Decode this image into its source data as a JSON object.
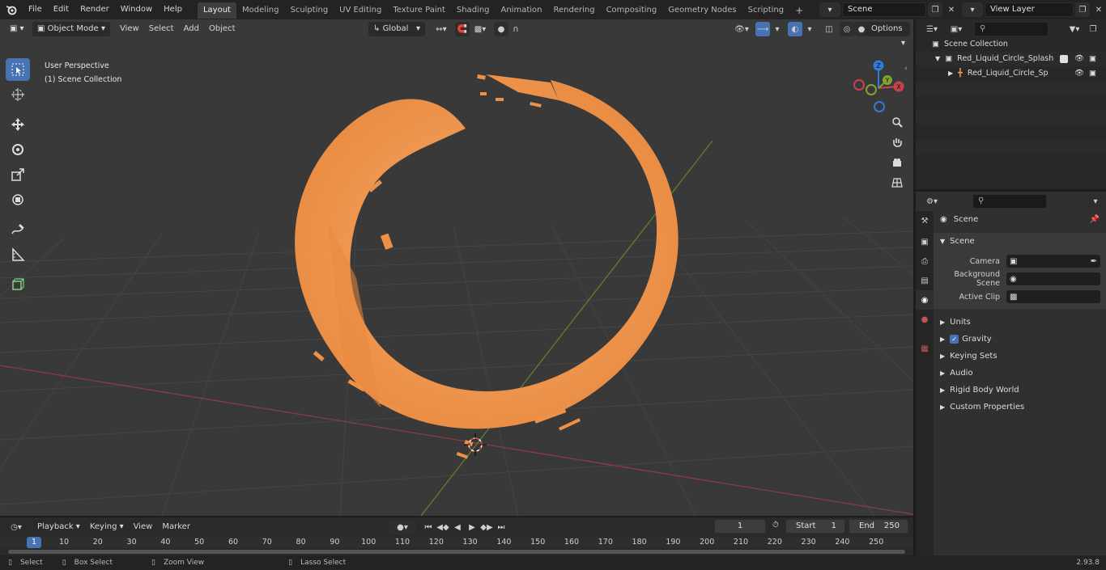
{
  "topbar": {
    "menus": [
      "File",
      "Edit",
      "Render",
      "Window",
      "Help"
    ],
    "workspaces": [
      "Layout",
      "Modeling",
      "Sculpting",
      "UV Editing",
      "Texture Paint",
      "Shading",
      "Animation",
      "Rendering",
      "Compositing",
      "Geometry Nodes",
      "Scripting"
    ],
    "active_workspace": "Layout",
    "add_tab": "+",
    "scene": "Scene",
    "view_layer": "View Layer"
  },
  "viewport": {
    "mode": "Object Mode",
    "menus": [
      "View",
      "Select",
      "Add",
      "Object"
    ],
    "transform_orientation": "Global",
    "options": "Options",
    "overlay_title": "User Perspective",
    "overlay_subtitle": "(1) Scene Collection",
    "gizmo": {
      "x": "X",
      "y": "Y",
      "z": "Z"
    }
  },
  "outliner": {
    "rows": [
      {
        "label": "Scene Collection"
      },
      {
        "label": "Red_Liquid_Circle_Splash"
      },
      {
        "label": "Red_Liquid_Circle_Splash"
      }
    ]
  },
  "properties": {
    "context": "Scene",
    "panel": "Scene",
    "fields": [
      {
        "label": "Camera"
      },
      {
        "label": "Background Scene"
      },
      {
        "label": "Active Clip"
      }
    ],
    "sections": [
      "Units",
      "Gravity",
      "Keying Sets",
      "Audio",
      "Rigid Body World",
      "Custom Properties"
    ]
  },
  "timeline": {
    "menus": [
      "Playback",
      "Keying",
      "View",
      "Marker"
    ],
    "current_frame": "1",
    "start_label": "Start",
    "start": "1",
    "end_label": "End",
    "end": "250",
    "ticks": [
      "1",
      "10",
      "20",
      "30",
      "40",
      "50",
      "60",
      "70",
      "80",
      "90",
      "100",
      "110",
      "120",
      "130",
      "140",
      "150",
      "160",
      "170",
      "180",
      "190",
      "200",
      "210",
      "220",
      "230",
      "240",
      "250"
    ]
  },
  "statusbar": {
    "select": "Select",
    "box_select": "Box Select",
    "zoom_view": "Zoom View",
    "lasso_select": "Lasso Select",
    "version": "2.93.8"
  },
  "colors": {
    "accent": "#4772b3",
    "splash": "#ee9148",
    "x_axis": "#c8414f",
    "y_axis": "#7fa52f",
    "z_axis": "#2f7cd8"
  }
}
